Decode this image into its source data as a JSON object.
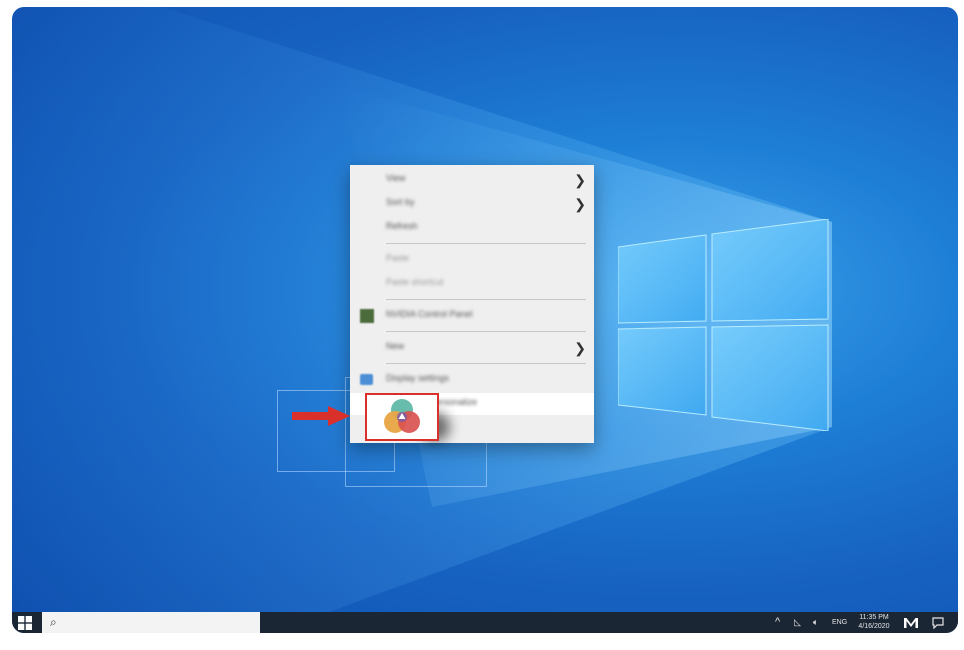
{
  "desktop": {
    "menu": {
      "items": [
        {
          "label": "View",
          "submenu": true
        },
        {
          "label": "Sort by",
          "submenu": true
        },
        {
          "label": "Refresh"
        },
        {
          "label": "Paste",
          "disabled": true
        },
        {
          "label": "Paste shortcut",
          "disabled": true
        },
        {
          "label": "NVIDIA Control Panel"
        },
        {
          "label": "New",
          "submenu": true
        },
        {
          "label": "Display settings"
        },
        {
          "label": "Personalize"
        }
      ]
    },
    "highlight_color": "#d9302c"
  },
  "taskbar": {
    "search_icon": "search-icon",
    "tray": {
      "chevron": "^",
      "language": "ENG",
      "time": "11:35 PM",
      "date": "4/16/2020"
    }
  }
}
